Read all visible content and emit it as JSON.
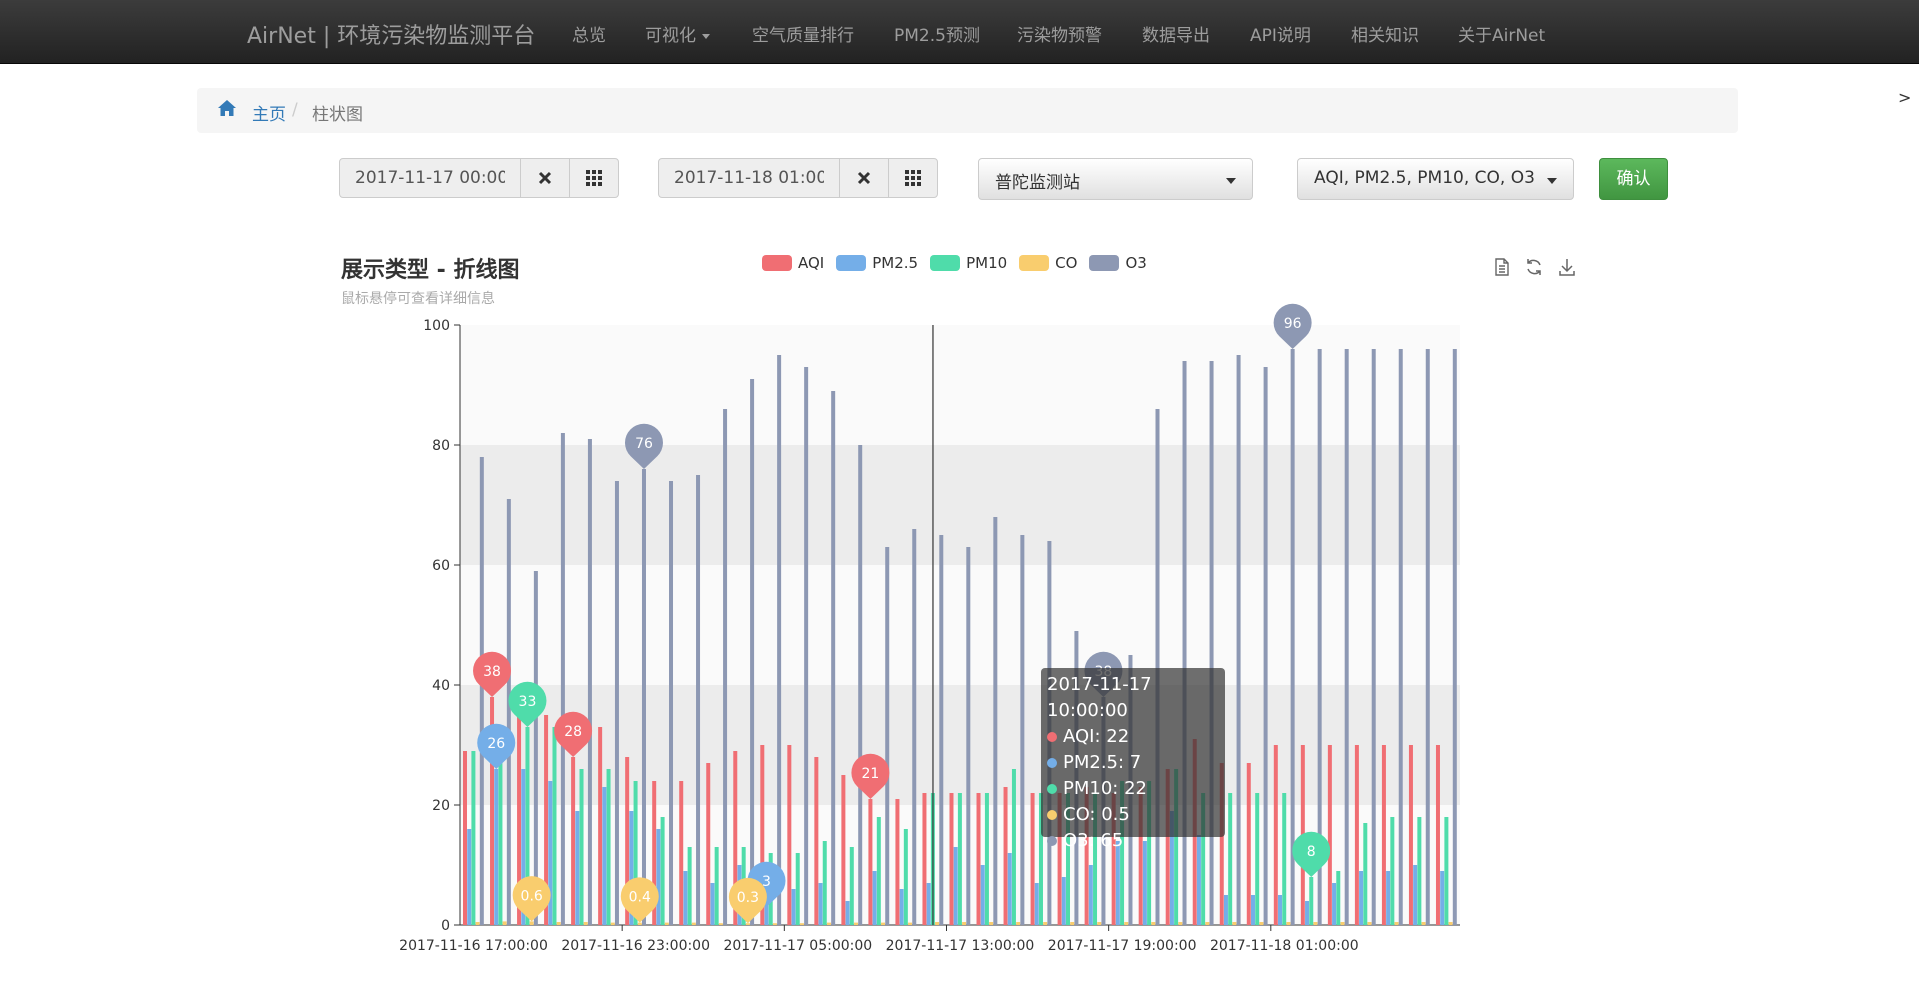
{
  "nav": {
    "brand": "AirNet | 环境污染物监测平台",
    "items": [
      "总览",
      "可视化",
      "空气质量排行",
      "PM2.5预测",
      "污染物预警",
      "数据导出",
      "API说明",
      "相关知识",
      "关于AirNet"
    ]
  },
  "side_arrow": ">",
  "breadcrumb": {
    "home": "主页",
    "sep": "/",
    "current": "柱状图"
  },
  "filters": {
    "start": "2017-11-17 00:00",
    "end": "2017-11-18 01:00",
    "station": "普陀监测站",
    "pollutants": "AQI, PM2.5, PM10, CO, O3",
    "confirm": "确认"
  },
  "colors": {
    "AQI": "#f06e73",
    "PM2.5": "#74aee8",
    "PM10": "#4fdcaa",
    "CO": "#f9cd6e",
    "O3": "#8d98b3"
  },
  "chart_data": {
    "type": "bar",
    "title": "展示类型 - 折线图",
    "subtitle": "鼠标悬停可查看详细信息",
    "ylim": [
      0,
      100
    ],
    "y_ticks": [
      0,
      20,
      40,
      60,
      80,
      100
    ],
    "x_tick_labels": [
      "2017-11-16 17:00:00",
      "2017-11-16 23:00:00",
      "2017-11-17 05:00:00",
      "2017-11-17 13:00:00",
      "2017-11-17 19:00:00",
      "2017-11-18 01:00:00"
    ],
    "series": [
      {
        "name": "AQI",
        "values": [
          29,
          38,
          36,
          35,
          28,
          33,
          28,
          24,
          24,
          27,
          29,
          30,
          30,
          28,
          25,
          21,
          21,
          22,
          22,
          22,
          23,
          22,
          22,
          23,
          22,
          23,
          26,
          31,
          27,
          27,
          30,
          30,
          30,
          30,
          30,
          30,
          30
        ]
      },
      {
        "name": "PM2.5",
        "values": [
          16,
          26,
          26,
          24,
          19,
          23,
          19,
          16,
          9,
          7,
          10,
          7,
          6,
          7,
          4,
          9,
          6,
          7,
          13,
          10,
          12,
          7,
          8,
          10,
          14,
          14,
          19,
          15,
          5,
          5,
          5,
          4,
          7,
          9,
          9,
          10,
          9
        ]
      },
      {
        "name": "PM10",
        "values": [
          29,
          28,
          33,
          33,
          26,
          26,
          24,
          18,
          13,
          13,
          13,
          12,
          12,
          14,
          13,
          18,
          16,
          22,
          22,
          22,
          26,
          22,
          22,
          22,
          24,
          24,
          26,
          22,
          22,
          22,
          22,
          8,
          9,
          17,
          18,
          18,
          18
        ]
      },
      {
        "name": "CO",
        "values": [
          0.5,
          0.6,
          0.6,
          0.5,
          0.5,
          0.4,
          0.4,
          0.4,
          0.4,
          0.3,
          0.3,
          0.3,
          0.3,
          0.4,
          0.4,
          0.4,
          0.4,
          0.5,
          0.5,
          0.5,
          0.5,
          0.5,
          0.5,
          0.5,
          0.5,
          0.5,
          0.5,
          0.5,
          0.5,
          0.5,
          0.5,
          0.5,
          0.5,
          0.5,
          0.5,
          0.5,
          0.5
        ]
      },
      {
        "name": "O3",
        "values": [
          78,
          71,
          59,
          82,
          81,
          74,
          76,
          74,
          75,
          86,
          91,
          95,
          93,
          89,
          80,
          63,
          66,
          65,
          63,
          68,
          65,
          64,
          49,
          38,
          45,
          86,
          94,
          94,
          95,
          93,
          96,
          96,
          96,
          96,
          96,
          96,
          96
        ]
      }
    ],
    "markers": [
      {
        "series": "AQI",
        "label": "38",
        "index": 1,
        "value": 38
      },
      {
        "series": "AQI",
        "label": "28",
        "index": 4,
        "value": 28
      },
      {
        "series": "AQI",
        "label": "21",
        "index": 15,
        "value": 21
      },
      {
        "series": "PM2.5",
        "label": "26",
        "index": 1,
        "value": 26
      },
      {
        "series": "PM2.5",
        "label": "3",
        "index": 11,
        "value": 3
      },
      {
        "series": "PM10",
        "label": "33",
        "index": 2,
        "value": 33
      },
      {
        "series": "PM10",
        "label": "8",
        "index": 31,
        "value": 8
      },
      {
        "series": "CO",
        "label": "0.6",
        "index": 2,
        "value": 0.6
      },
      {
        "series": "CO",
        "label": "0.4",
        "index": 6,
        "value": 0.4
      },
      {
        "series": "CO",
        "label": "0.3",
        "index": 10,
        "value": 0.3
      },
      {
        "series": "O3",
        "label": "76",
        "index": 6,
        "value": 76
      },
      {
        "series": "O3",
        "label": "38",
        "index": 23,
        "value": 38
      },
      {
        "series": "O3",
        "label": "96",
        "index": 30,
        "value": 96
      }
    ]
  },
  "tooltip": {
    "time": "2017-11-17 10:00:00",
    "rows": [
      "AQI: 22",
      "PM2.5: 7",
      "PM10: 22",
      "CO: 0.5",
      "O3: 65"
    ]
  }
}
